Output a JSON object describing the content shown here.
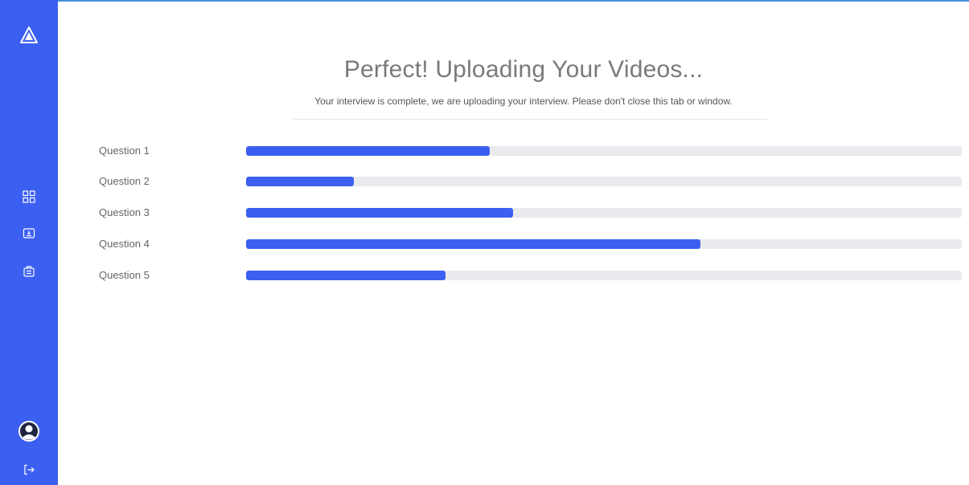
{
  "app": {
    "accent_color": "#3b5ff0",
    "track_color": "#e8eaed"
  },
  "sidebar": {
    "logo_icon": "triangle-logo-icon",
    "nav_items": [
      {
        "icon": "dashboard-grid-icon"
      },
      {
        "icon": "monitor-icon"
      },
      {
        "icon": "briefcase-icon"
      }
    ],
    "bottom_items": [
      {
        "icon": "user-avatar-icon"
      },
      {
        "icon": "logout-icon"
      }
    ]
  },
  "main": {
    "title": "Perfect! Uploading Your Videos...",
    "subtitle": "Your interview is complete, we are uploading your interview. Please don't close this tab or window."
  },
  "questions": [
    {
      "label": "Question 1",
      "progress": 0.34
    },
    {
      "label": "Question 2",
      "progress": 0.15
    },
    {
      "label": "Question 3",
      "progress": 0.373
    },
    {
      "label": "Question 4",
      "progress": 0.635
    },
    {
      "label": "Question 5",
      "progress": 0.279
    }
  ]
}
